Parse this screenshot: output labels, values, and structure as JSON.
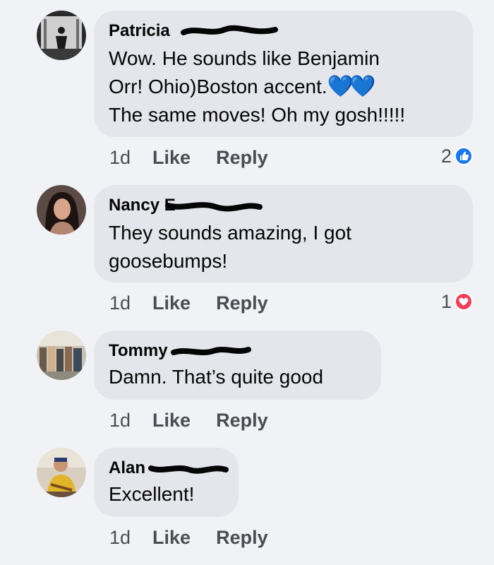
{
  "comments": [
    {
      "author": "Patricia",
      "text": "Wow. He sounds like Benjamin\nOrr! Ohio)Boston accent.",
      "text_tail": "The same moves! Oh my gosh!!!!!",
      "emoji": "💙💙",
      "time": "1d",
      "like": "Like",
      "reply": "Reply",
      "reaction_count": "2",
      "reaction_icon": "like-icon"
    },
    {
      "author": "Nancy E",
      "text": "They sounds amazing, I got\ngoosebumps!",
      "time": "1d",
      "like": "Like",
      "reply": "Reply",
      "reaction_count": "1",
      "reaction_icon": "heart-icon"
    },
    {
      "author": "Tommy",
      "text": "Damn. That’s quite good",
      "time": "1d",
      "like": "Like",
      "reply": "Reply"
    },
    {
      "author": "Alan",
      "text": "Excellent!",
      "time": "1d",
      "like": "Like",
      "reply": "Reply"
    }
  ],
  "colors": {
    "background": "#f0f2f5",
    "bubble": "#e4e6eb",
    "like_blue": "#1877f2",
    "heart_red": "#f33e58"
  }
}
